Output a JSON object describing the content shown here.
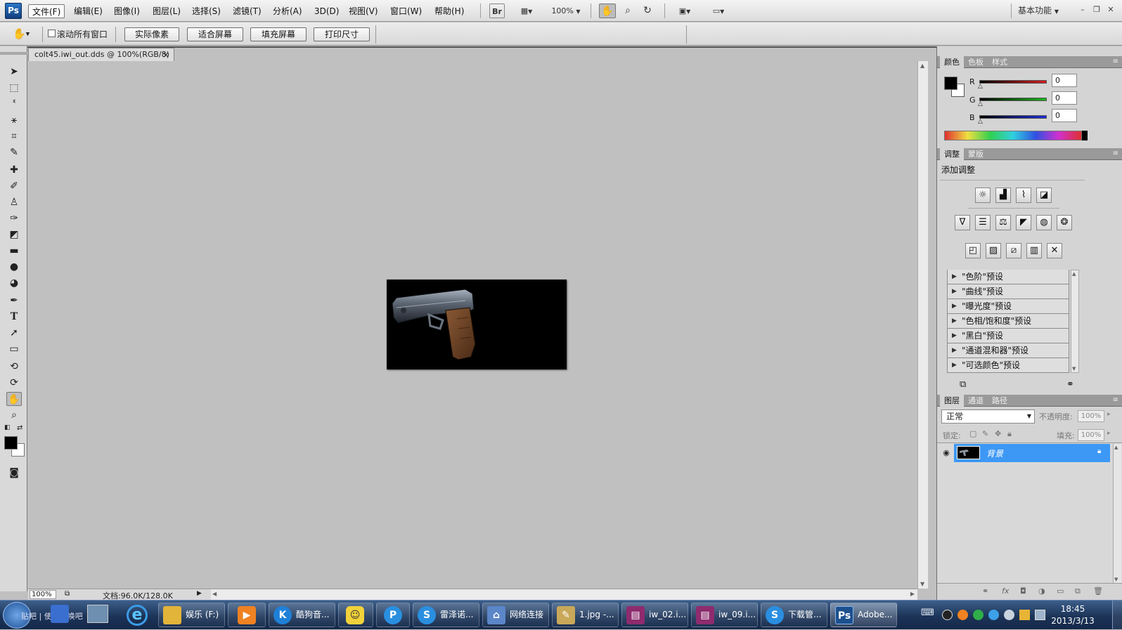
{
  "app": {
    "logo": "Ps",
    "workspace": "基本功能",
    "zoom": "100%"
  },
  "menu": [
    "文件(F)",
    "编辑(E)",
    "图像(I)",
    "图层(L)",
    "选择(S)",
    "滤镜(T)",
    "分析(A)",
    "3D(D)",
    "视图(V)",
    "窗口(W)",
    "帮助(H)"
  ],
  "appbar": {
    "bridge": "Br",
    "zoom_value": "100%"
  },
  "options": {
    "scroll_all_label": "滚动所有窗口",
    "buttons": [
      "实际像素",
      "适合屏幕",
      "填充屏幕",
      "打印尺寸"
    ]
  },
  "document": {
    "tab_title": "colt45.iwi_out.dds @ 100%(RGB/8)",
    "close_glyph": "×",
    "status_zoom": "100%",
    "status_doc": "文档:96.0K/128.0K"
  },
  "color_panel": {
    "tabs": [
      "颜色",
      "色板",
      "样式"
    ],
    "channels": [
      {
        "label": "R",
        "value": "0",
        "color": "#d81e1e"
      },
      {
        "label": "G",
        "value": "0",
        "color": "#1bb51b"
      },
      {
        "label": "B",
        "value": "0",
        "color": "#1e2ed8"
      }
    ]
  },
  "adjust_panel": {
    "tabs": [
      "调整",
      "蒙版"
    ],
    "title": "添加调整",
    "presets": [
      "\"色阶\"预设",
      "\"曲线\"预设",
      "\"曝光度\"预设",
      "\"色相/饱和度\"预设",
      "\"黑白\"预设",
      "\"通道混和器\"预设",
      "\"可选颜色\"预设"
    ]
  },
  "layers_panel": {
    "tabs": [
      "图层",
      "通道",
      "路径"
    ],
    "blend_mode": "正常",
    "opacity_label": "不透明度:",
    "opacity_value": "100%",
    "lock_label": "锁定:",
    "fill_label": "填充:",
    "fill_value": "100%",
    "layer_name": "背景",
    "selected_color": "#3d98f5"
  },
  "taskbar": {
    "tasks": [
      {
        "label": "娱乐 (F:)",
        "icon": "folder-icon"
      },
      {
        "label": "",
        "icon": "media-player-icon"
      },
      {
        "label": "酷狗音...",
        "icon": "kugou-icon"
      },
      {
        "label": "",
        "icon": "pps-icon"
      },
      {
        "label": "",
        "icon": "pinyin-icon"
      },
      {
        "label": "雷泽诺...",
        "icon": "chat-icon"
      },
      {
        "label": "网络连接",
        "icon": "network-icon"
      },
      {
        "label": "1.jpg -...",
        "icon": "paint-icon"
      },
      {
        "label": "iw_02.i...",
        "icon": "winrar-icon"
      },
      {
        "label": "iw_09.i...",
        "icon": "winrar-icon"
      },
      {
        "label": "下载管...",
        "icon": "download-icon"
      },
      {
        "label": "Adobe...",
        "icon": "photoshop-icon"
      }
    ],
    "start_text": "贴吧 | 使命召唤吧",
    "time": "18:45",
    "date": "2013/3/13"
  }
}
